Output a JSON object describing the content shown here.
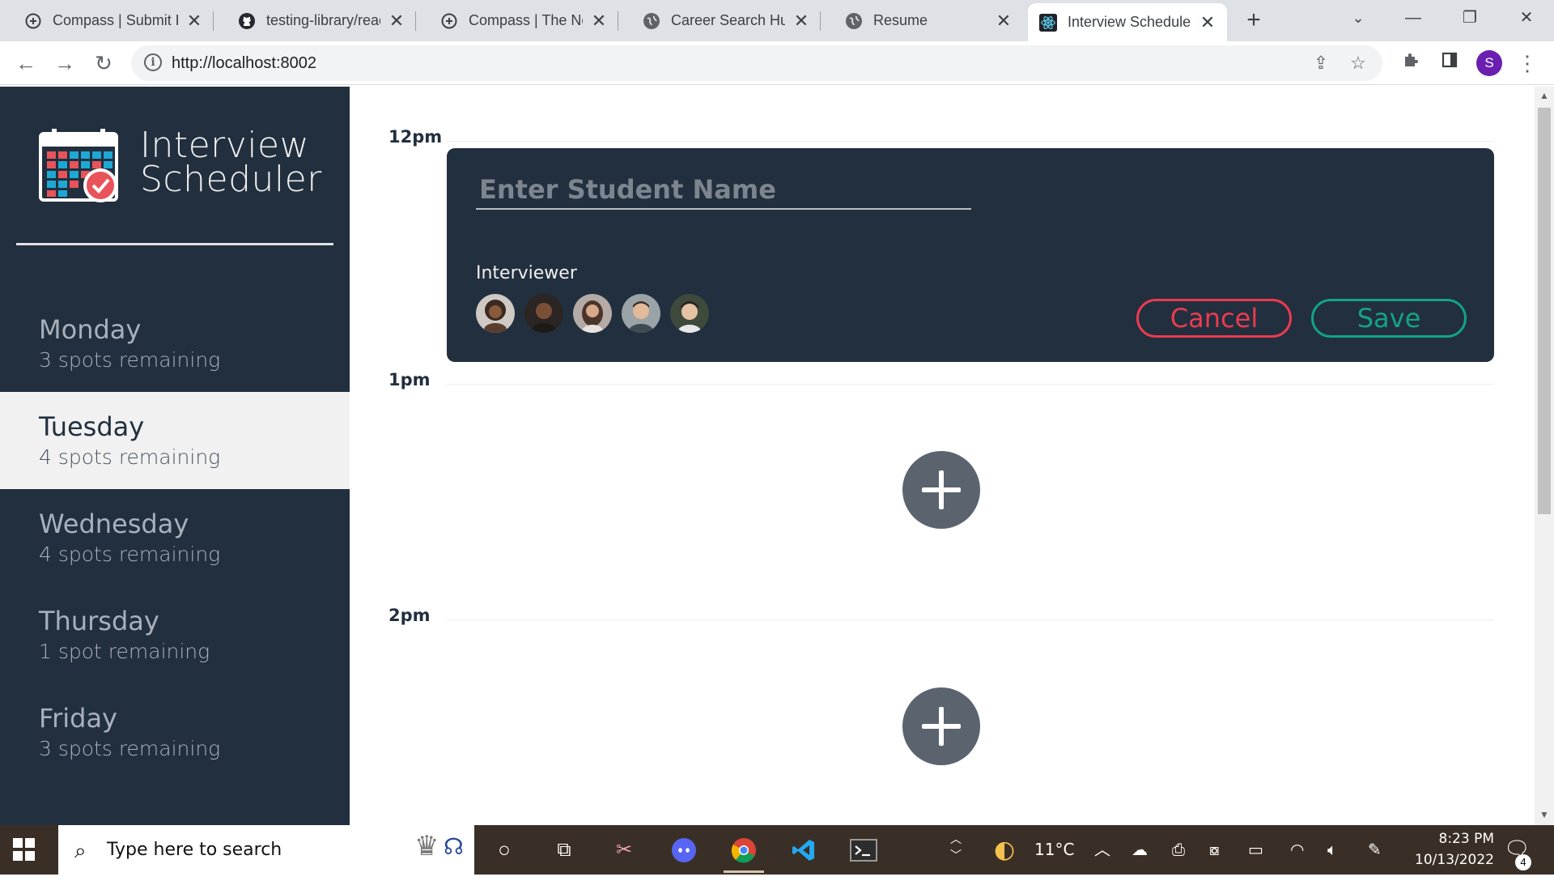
{
  "browser": {
    "tabs": [
      {
        "title": "Compass | Submit P",
        "icon": "compass-icon",
        "active": false
      },
      {
        "title": "testing-library/react",
        "icon": "github-icon",
        "active": false
      },
      {
        "title": "Compass | The Next",
        "icon": "compass-icon",
        "active": false
      },
      {
        "title": "Career Search Hub",
        "icon": "globe-icon",
        "active": false
      },
      {
        "title": "Resume",
        "icon": "globe-icon",
        "active": false
      },
      {
        "title": "Interview Scheduler",
        "icon": "react-icon",
        "active": true
      }
    ],
    "url": "http://localhost:8002",
    "profile_initial": "S"
  },
  "app": {
    "title_line1": "Interview",
    "title_line2": "Scheduler",
    "days": [
      {
        "name": "Monday",
        "spots": "3 spots remaining",
        "selected": false
      },
      {
        "name": "Tuesday",
        "spots": "4 spots remaining",
        "selected": true
      },
      {
        "name": "Wednesday",
        "spots": "4 spots remaining",
        "selected": false
      },
      {
        "name": "Thursday",
        "spots": "1 spot remaining",
        "selected": false
      },
      {
        "name": "Friday",
        "spots": "3 spots remaining",
        "selected": false
      }
    ],
    "times": [
      "12pm",
      "1pm",
      "2pm"
    ],
    "form": {
      "name_placeholder": "Enter Student Name",
      "name_value": "",
      "interviewer_label": "Interviewer",
      "cancel_label": "Cancel",
      "save_label": "Save"
    },
    "colors": {
      "sidebar_bg": "#222f3e",
      "cancel": "#ec3b4f",
      "save": "#14a383",
      "add_button": "#5b646e"
    }
  },
  "taskbar": {
    "search_placeholder": "Type here to search",
    "temperature": "11°C",
    "time": "8:23 PM",
    "date": "10/13/2022",
    "notifications": "4"
  }
}
